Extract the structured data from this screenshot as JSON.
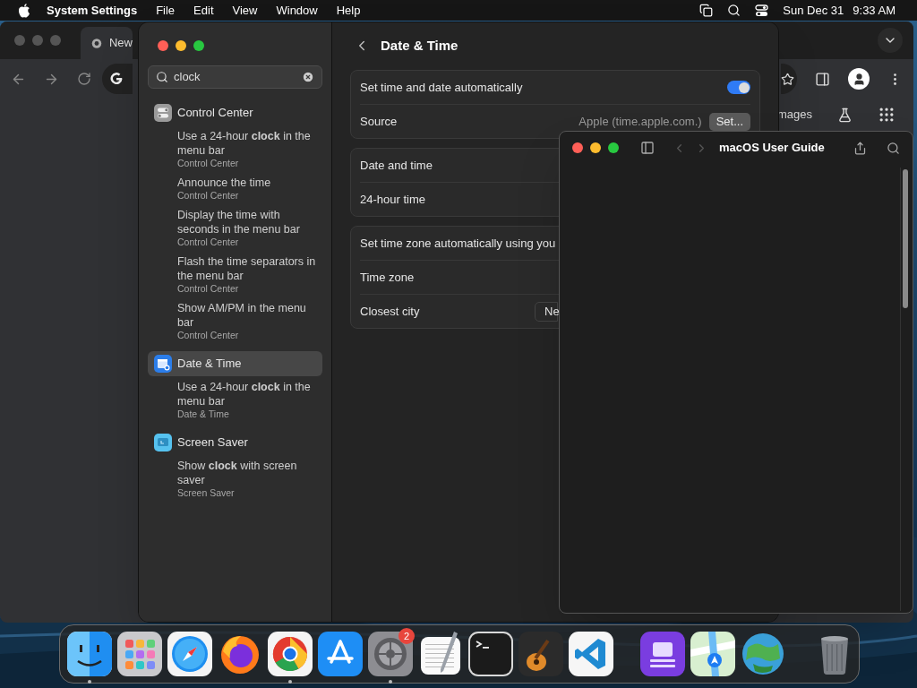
{
  "menu_bar": {
    "app_name": "System Settings",
    "menus": [
      "File",
      "Edit",
      "View",
      "Window",
      "Help"
    ],
    "date": "Sun Dec 31",
    "time": "9:33 AM"
  },
  "browser": {
    "tab_title": "New",
    "page_link": "mages"
  },
  "settings": {
    "search": {
      "value": "clock"
    },
    "results": [
      {
        "kind": "control_center",
        "title": "Control Center",
        "selected": false,
        "items": [
          {
            "text": "Use a 24-hour **clock** in the menu bar",
            "section": "Control Center"
          },
          {
            "text": "Announce the time",
            "section": "Control Center"
          },
          {
            "text": "Display the time with seconds in the menu bar",
            "section": "Control Center"
          },
          {
            "text": "Flash the time separators in the menu bar",
            "section": "Control Center"
          },
          {
            "text": "Show AM/PM in the menu bar",
            "section": "Control Center"
          }
        ]
      },
      {
        "kind": "date_time",
        "title": "Date & Time",
        "selected": true,
        "items": [
          {
            "text": "Use a 24-hour **clock** in the menu bar",
            "section": "Date & Time"
          }
        ]
      },
      {
        "kind": "screen_saver",
        "title": "Screen Saver",
        "selected": false,
        "items": [
          {
            "text": "Show **clock** with screen saver",
            "section": "Screen Saver"
          }
        ]
      }
    ],
    "page": {
      "title": "Date & Time",
      "groups": [
        {
          "rows": [
            {
              "kind": "toggle",
              "label": "Set time and date automatically",
              "on": true
            },
            {
              "kind": "value",
              "label": "Source",
              "value": "Apple (time.apple.com.)",
              "button": "Set..."
            }
          ]
        },
        {
          "rows": [
            {
              "kind": "plain",
              "label": "Date and time"
            },
            {
              "kind": "plain",
              "label": "24-hour time"
            }
          ]
        },
        {
          "rows": [
            {
              "kind": "plain",
              "label": "Set time zone automatically using you"
            },
            {
              "kind": "plain",
              "label": "Time zone"
            },
            {
              "kind": "popup",
              "label": "Closest city",
              "value": "Ne"
            }
          ]
        }
      ]
    }
  },
  "help_window": {
    "title": "macOS User Guide"
  },
  "dock": {
    "items": [
      {
        "kind": "finder",
        "running": true
      },
      {
        "kind": "launchpad",
        "running": false
      },
      {
        "kind": "safari",
        "running": false
      },
      {
        "kind": "firefox",
        "running": false
      },
      {
        "kind": "chrome",
        "running": true
      },
      {
        "kind": "app_store",
        "running": false
      },
      {
        "kind": "settings",
        "running": true,
        "badge": "2"
      },
      {
        "kind": "textedit",
        "running": false
      },
      {
        "kind": "terminal",
        "running": false
      },
      {
        "kind": "garageband",
        "running": false
      },
      {
        "kind": "vscode",
        "running": false
      },
      {
        "kind": "separator"
      },
      {
        "kind": "utility",
        "running": false
      },
      {
        "kind": "maps",
        "running": false
      },
      {
        "kind": "globe_app",
        "running": false
      },
      {
        "kind": "separator"
      },
      {
        "kind": "trash",
        "running": false
      }
    ]
  }
}
